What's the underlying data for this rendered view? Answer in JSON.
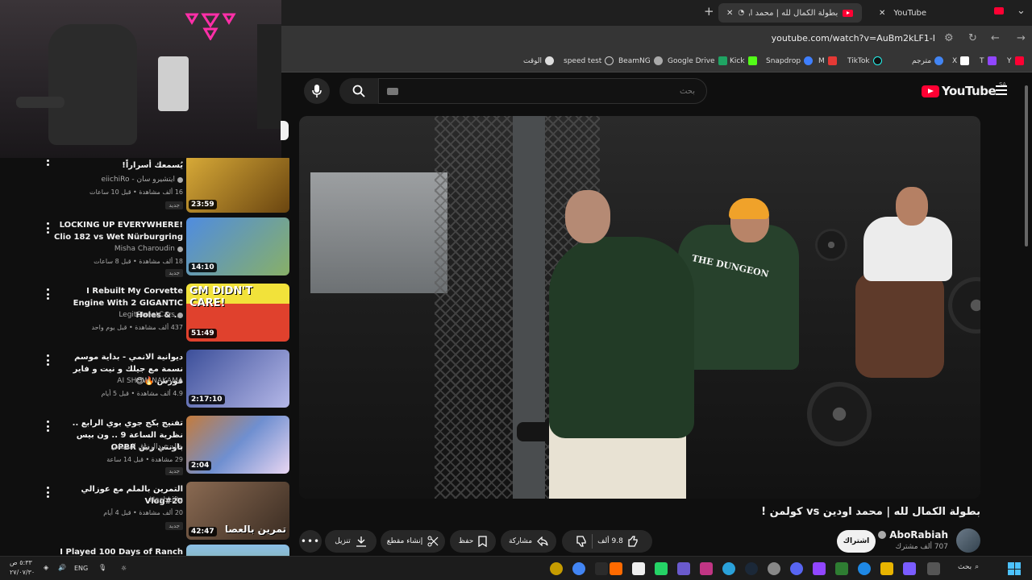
{
  "browser": {
    "tabs": [
      {
        "title": "YouTube",
        "active": false
      },
      {
        "title": "بطولة الكمال لله | محمد اودين vs كولمن !",
        "active": true
      }
    ],
    "new_tab": "+",
    "url": "youtube.com/watch?v=AuBm2kLF1-I"
  },
  "bookmarks": [
    {
      "label": "Y"
    },
    {
      "label": "T"
    },
    {
      "label": "X"
    },
    {
      "label": "مترجم"
    },
    {
      "label": "TikTok"
    },
    {
      "label": "M"
    },
    {
      "label": "Snapdrop"
    },
    {
      "label": "Kick"
    },
    {
      "label": "Google Drive"
    },
    {
      "label": "BeamNG"
    },
    {
      "label": "speed test"
    },
    {
      "label": "الوقت"
    }
  ],
  "youtube": {
    "logo": "YouTube",
    "region": "SA",
    "search_placeholder": "بحث"
  },
  "video": {
    "title": "بطولة الكمال لله | محمد اودين vs كولمن !",
    "shirt_text": "THE DUNGEON",
    "channel": "AboRabiah",
    "subscribers": "707 ألف مشترك",
    "subscribe_label": "اشتراك",
    "likes": "9.8 ألف",
    "share_label": "مشاركة",
    "save_label": "حفظ",
    "clip_label": "إنشاء مقطع",
    "download_label": "تنزيل"
  },
  "recommendations": [
    {
      "title": "يُسمعك أسراراً!",
      "channel": "eiichiRo - ايتشيرو سان",
      "meta": "16 ألف مشاهدة • قبل 10 ساعات",
      "badge": "جديد",
      "duration": "23:59",
      "color": "#c89a2a",
      "ltr": false
    },
    {
      "title": "LOCKING UP EVERYWHERE! Clio 182 vs Wet Nürburgring",
      "channel": "Misha Charoudin",
      "meta": "18 ألف مشاهدة • قبل 8 ساعات",
      "badge": "جديد",
      "duration": "14:10",
      "color": "#3b6fc6",
      "ltr": true
    },
    {
      "title": "I Rebuilt My Corvette Engine With 2 GIGANTIC Holes & ...",
      "channel": "LegitStreetCars",
      "meta": "437 ألف مشاهدة • قبل يوم واحد",
      "badge": "",
      "duration": "51:49",
      "color": "#d63c2a",
      "thumb_text": "GM DIDN'T CARE!",
      "ltr": true
    },
    {
      "title": "دیوانیة الانمي - بداية موسم نسمة مع جيلك و نيت و فاير فورس 🔥😍",
      "channel": "AI SHOW NAKAMA",
      "meta": "4.9 ألف مشاهدة • قبل 5 أيام",
      "badge": "",
      "duration": "2:17:10",
      "color": "#5a4fa0",
      "ltr": false
    },
    {
      "title": "تفنيج بكج جوي بوي الرابع .. نظرية الساعة 9 .. ون بيس باونتي رش OPBR",
      "channel": "خالد عبدالرزاق الشيباني",
      "meta": "29 مشاهدة • قبل 14 ساعة",
      "badge": "جديد",
      "duration": "2:04",
      "color": "#6f8fd0",
      "ltr": false
    },
    {
      "title": "التمرين بالملم مع عوزالي Vlog#20",
      "channel": "HachLifts",
      "meta": "20 ألف مشاهدة • قبل 4 أيام",
      "badge": "جديد",
      "duration": "42:47",
      "color": "#7a5a40",
      "thumb_text": "تمرين بالعصا",
      "ltr": false
    },
    {
      "title": "I Played 100 Days of Ranch",
      "channel": "",
      "meta": "",
      "badge": "",
      "duration": "",
      "color": "#7fa34d",
      "ltr": true
    }
  ],
  "taskbar": {
    "search": "بحث",
    "lang": "ENG",
    "time": "٥:٣٣ ص",
    "date": "٢٧/٠٧/٣٠"
  },
  "colors": {
    "brand_red": "#ff0033",
    "background": "#0f0f0f",
    "pill": "#272727"
  }
}
